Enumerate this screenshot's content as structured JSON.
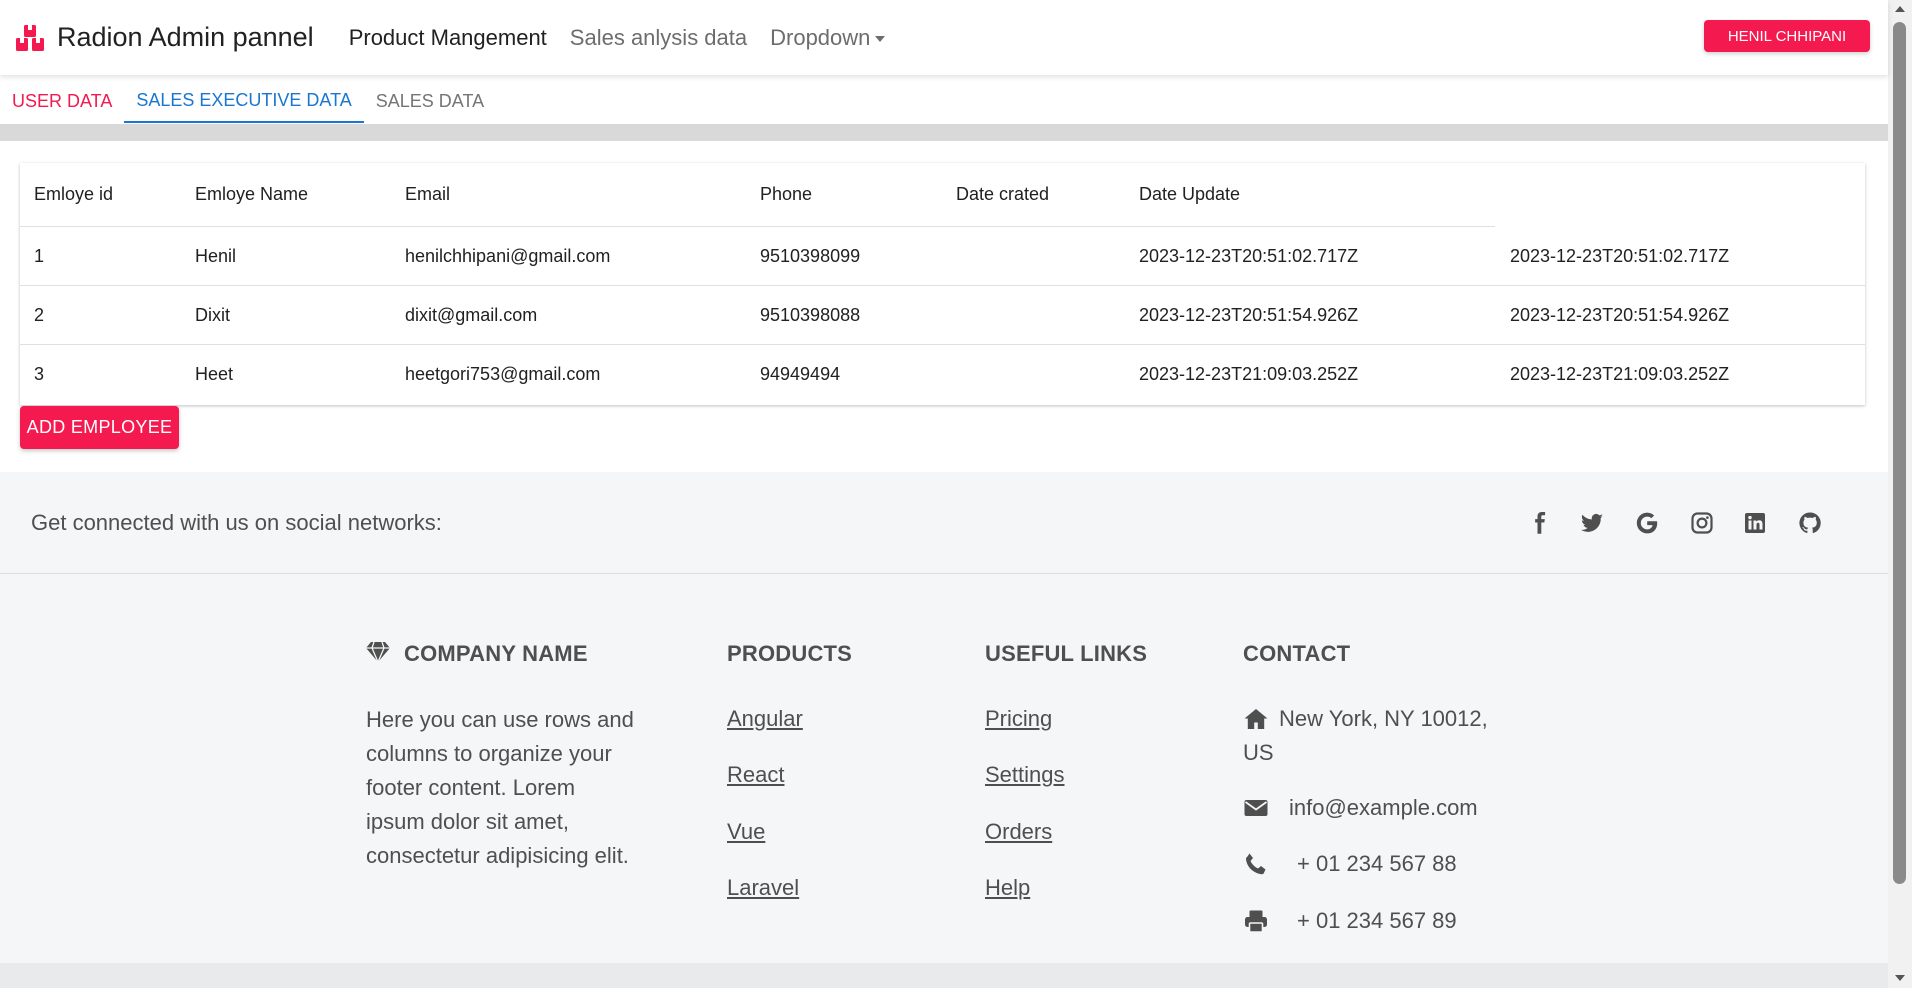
{
  "navbar": {
    "brand": "Radion Admin pannel",
    "links": [
      "Product Mangement",
      "Sales anlysis data",
      "Dropdown"
    ],
    "user_button": "HENIL CHHIPANI"
  },
  "tabs": [
    "USER DATA",
    "SALES EXECUTIVE DATA",
    "SALES DATA"
  ],
  "table": {
    "headers": [
      "Emloye id",
      "Emloye Name",
      "Email",
      "Phone",
      "Date crated",
      "Date Update"
    ],
    "rows": [
      [
        "1",
        "Henil",
        "henilchhipani@gmail.com",
        "9510398099",
        "",
        "2023-12-23T20:51:02.717Z",
        "2023-12-23T20:51:02.717Z"
      ],
      [
        "2",
        "Dixit",
        "dixit@gmail.com",
        "9510398088",
        "",
        "2023-12-23T20:51:54.926Z",
        "2023-12-23T20:51:54.926Z"
      ],
      [
        "3",
        "Heet",
        "heetgori753@gmail.com",
        "94949494",
        "",
        "2023-12-23T21:09:03.252Z",
        "2023-12-23T21:09:03.252Z"
      ]
    ]
  },
  "add_button": "ADD EMPLOYEE",
  "footer": {
    "social_text": "Get connected with us on social networks:",
    "social_icons": [
      "facebook-icon",
      "twitter-icon",
      "google-icon",
      "instagram-icon",
      "linkedin-icon",
      "github-icon"
    ],
    "company": {
      "title": "COMPANY NAME",
      "text_lines": [
        "Here you can use rows and",
        "columns to organize your",
        "footer content. Lorem",
        "ipsum dolor sit amet,",
        "consectetur adipisicing elit."
      ]
    },
    "products": {
      "title": "PRODUCTS",
      "links": [
        "Angular",
        "React",
        "Vue",
        "Laravel"
      ]
    },
    "useful_links": {
      "title": "USEFUL LINKS",
      "links": [
        "Pricing",
        "Settings",
        "Orders",
        "Help"
      ]
    },
    "contact": {
      "title": "CONTACT",
      "address_line1": "New York, NY 10012,",
      "address_line2": "US",
      "email": "info@example.com",
      "phone": "+ 01 234 567 88",
      "fax": "+ 01 234 567 89"
    }
  },
  "colors": {
    "accent": "#f4194f",
    "active_tab": "#1976d2"
  }
}
